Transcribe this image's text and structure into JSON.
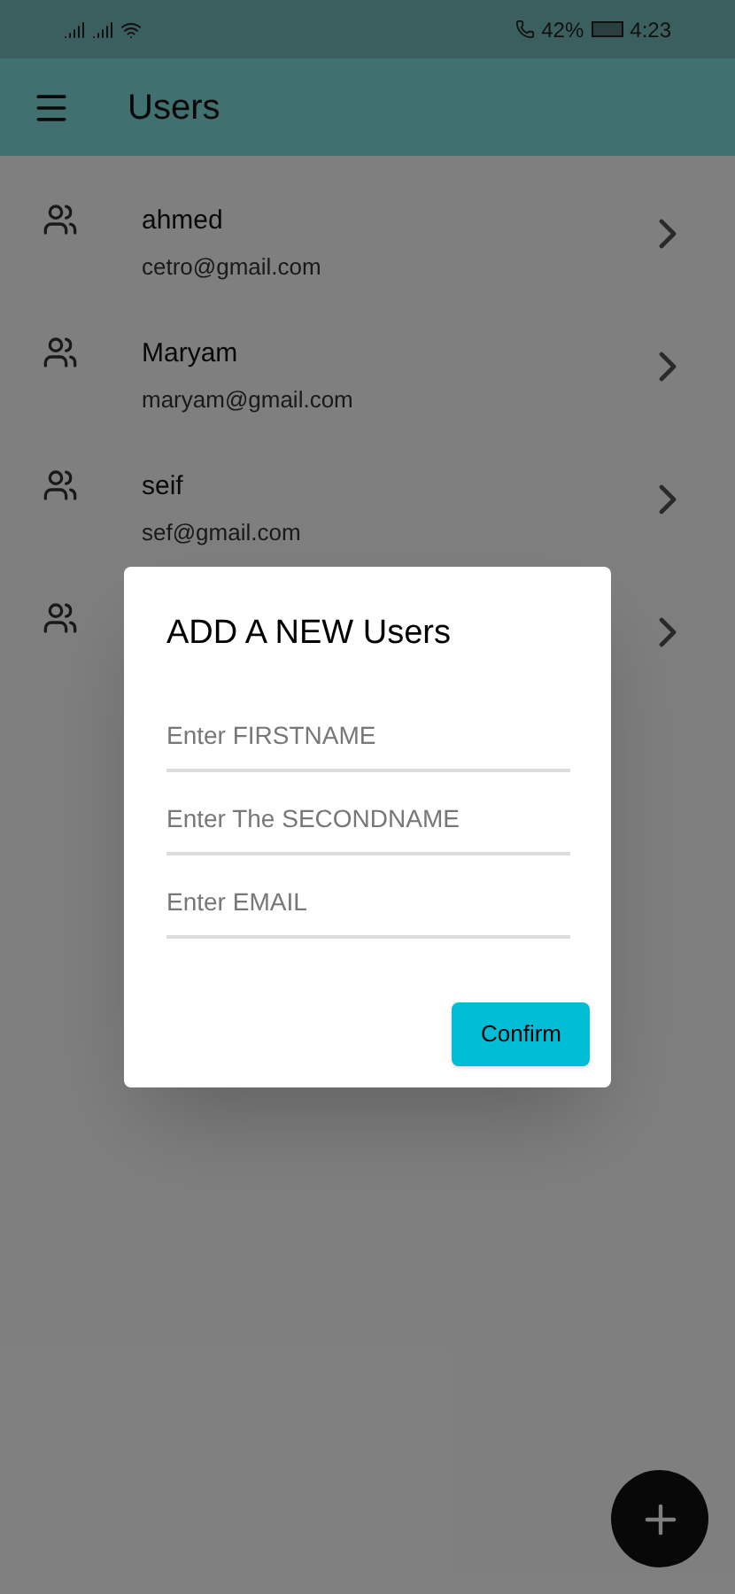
{
  "status_bar": {
    "battery": "42%",
    "time": "4:23"
  },
  "app_bar": {
    "title": "Users"
  },
  "users": [
    {
      "kind": "full",
      "name": "ahmed",
      "email": "cetro@gmail.com"
    },
    {
      "kind": "full",
      "name": "Maryam",
      "email": "maryam@gmail.com"
    },
    {
      "kind": "full",
      "name": "seif",
      "email": "sef@gmail.com"
    },
    {
      "kind": "covered"
    }
  ],
  "dialog": {
    "title": "ADD A NEW Users",
    "fields": [
      {
        "placeholder": "Enter FIRSTNAME"
      },
      {
        "placeholder": "Enter The SECONDNAME"
      },
      {
        "placeholder": "Enter EMAIL"
      }
    ],
    "confirm": "Confirm"
  }
}
